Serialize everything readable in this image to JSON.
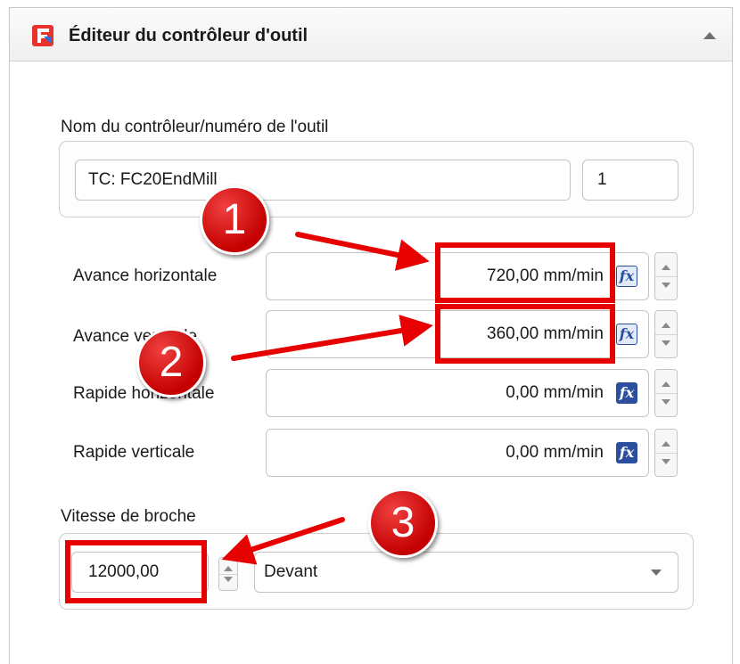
{
  "header": {
    "title": "Éditeur du contrôleur d'outil",
    "logo_icon": "freecad-logo-icon",
    "collapse_icon": "collapse-up-icon"
  },
  "tool": {
    "label": "Nom du contrôleur/numéro de l'outil",
    "name_value": "TC: FC20EndMill",
    "number_value": "1"
  },
  "feeds": [
    {
      "label": "Avance horizontale",
      "value": "720,00 mm/min"
    },
    {
      "label": "Avance verticale",
      "value": "360,00 mm/min"
    },
    {
      "label": "Rapide horizontale",
      "value": "0,00 mm/min"
    },
    {
      "label": "Rapide verticale",
      "value": "0,00 mm/min"
    }
  ],
  "fx_label": "fx",
  "spindle": {
    "label": "Vitesse de broche",
    "speed_value": "12000,00",
    "direction_value": "Devant"
  },
  "annotations": [
    "1",
    "2",
    "3"
  ],
  "colors": {
    "annotation_red": "#e60000",
    "fx_blue": "#2b4f9e"
  }
}
